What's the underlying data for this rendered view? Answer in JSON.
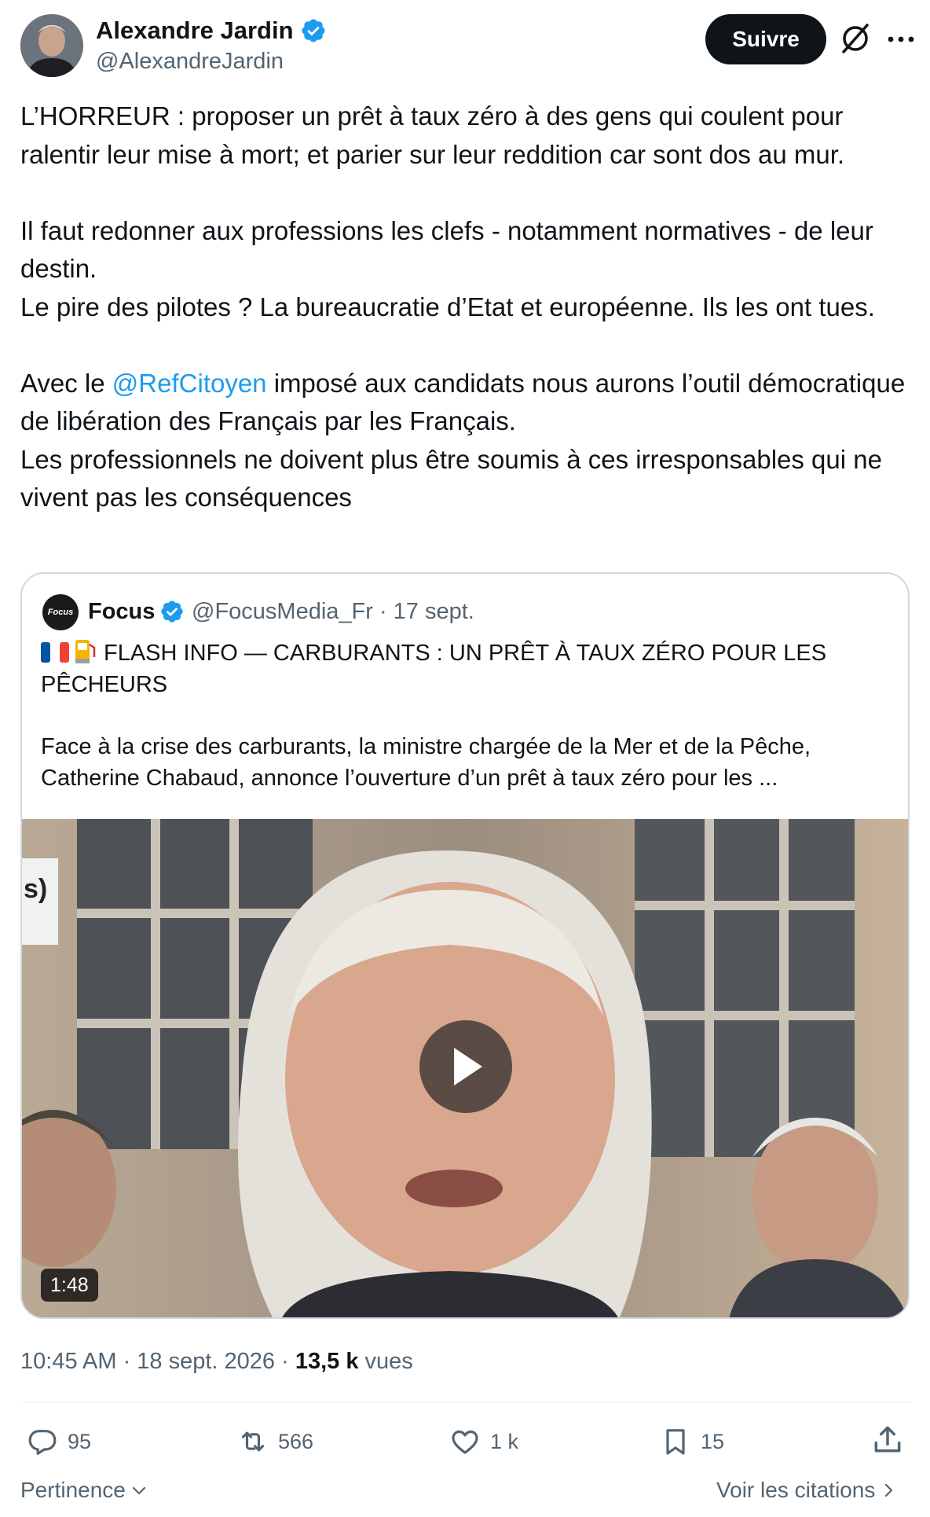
{
  "author": {
    "name": "Alexandre Jardin",
    "handle": "@AlexandreJardin",
    "follow_label": "Suivre"
  },
  "tweet": {
    "para1": "L’HORREUR : proposer un prêt à taux zéro à des gens qui coulent pour ralentir leur mise à mort; et parier sur leur reddition car sont dos au mur.",
    "para2": "Il faut redonner aux professions les clefs - notamment normatives - de leur destin.\nLe pire des pilotes ? La bureaucratie d’Etat et européenne. Ils les ont tues.",
    "para3_before": "Avec le ",
    "mention": "@RefCitoyen",
    "para3_after": " imposé aux candidats nous aurons l’outil démocratique de libération des Français par les Français.\nLes professionnels ne doivent plus être soumis à ces irresponsables qui ne vivent pas les conséquences"
  },
  "quote": {
    "avatar_text": "Focus",
    "name": "Focus",
    "meta": "@FocusMedia_Fr · 17 sept.",
    "headline": "FLASH INFO — CARBURANTS : UN PRÊT À TAUX ZÉRO POUR LES PÊCHEURS",
    "body": "Face à la crise des carburants, la ministre chargée de la Mer et de la Pêche, Catherine Chabaud, annonce l’ouverture d’un prêt à taux zéro pour les ...",
    "video_label": "s)",
    "duration": "1:48"
  },
  "meta": {
    "time_date": "10:45 AM · 18 sept. 2026 · ",
    "views_count": "13,5 k",
    "views_label": " vues"
  },
  "actions": {
    "replies": "95",
    "reposts": "566",
    "likes": "1 k",
    "bookmarks": "15"
  },
  "footer": {
    "sort_label": "Pertinence",
    "quotes_link": "Voir les citations"
  },
  "colors": {
    "accent": "#1d9bf0",
    "text": "#0f1419",
    "muted": "#536471",
    "border": "#cfd9de"
  }
}
